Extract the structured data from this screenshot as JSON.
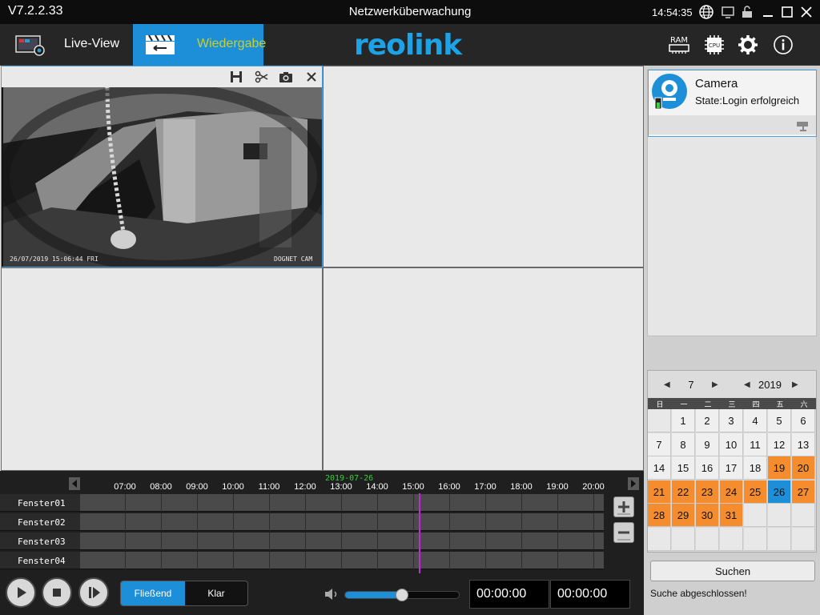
{
  "titlebar": {
    "version": "V7.2.2.33",
    "title": "Netzwerküberwachung",
    "clock": "14:54:35"
  },
  "header": {
    "tab_live": "Live-View",
    "tab_playback": "Wiedergabe",
    "ram_label": "RAM",
    "cpu_label": "CPU"
  },
  "camera_view": {
    "timestamp": "26/07/2019 15:06:44 FRI",
    "cam_label": "DOGNET CAM"
  },
  "timeline": {
    "date": "2019-07-26",
    "hours": [
      "07:00",
      "08:00",
      "09:00",
      "10:00",
      "11:00",
      "12:00",
      "13:00",
      "14:00",
      "15:00",
      "16:00",
      "17:00",
      "18:00",
      "19:00",
      "20:00"
    ],
    "rows": [
      "Fenster01",
      "Fenster02",
      "Fenster03",
      "Fenster04"
    ]
  },
  "controls": {
    "mode_fluent": "Fließend",
    "mode_clear": "Klar",
    "volume": 0.5,
    "time_start": "00:00:00",
    "time_end": "00:00:00"
  },
  "device": {
    "name": "Camera",
    "state": "State:Login erfolgreich"
  },
  "calendar": {
    "month": "7",
    "year": "2019",
    "weekdays": [
      "日",
      "一",
      "二",
      "三",
      "四",
      "五",
      "六"
    ],
    "first_weekday": 1,
    "days_in_month": 31,
    "recording_days": [
      19,
      20,
      21,
      22,
      23,
      24,
      25,
      27,
      28,
      29,
      30,
      31
    ],
    "selected_day": 26
  },
  "search": {
    "button": "Suchen",
    "status": "Suche abgeschlossen!"
  },
  "colors": {
    "accent": "#1c8fd8",
    "recording": "#f58d2f",
    "playhead": "#c02ad6",
    "date_text": "#35d135"
  }
}
